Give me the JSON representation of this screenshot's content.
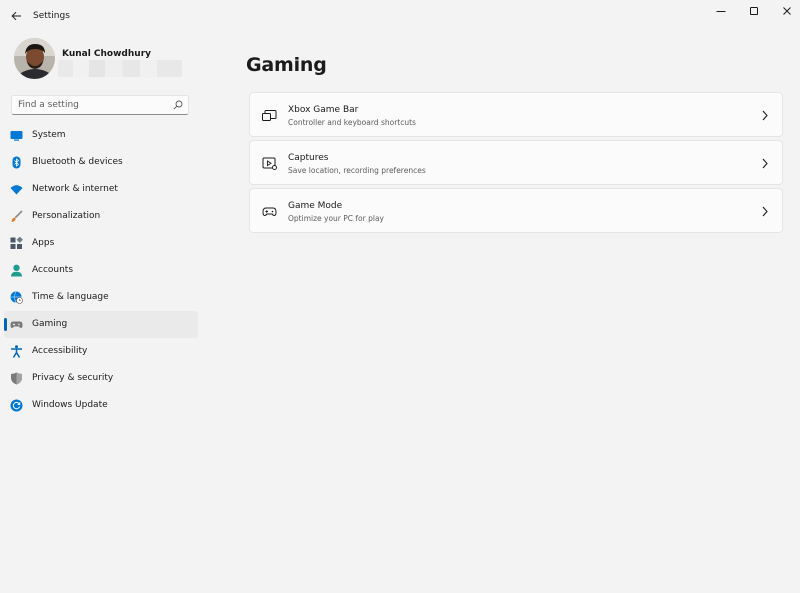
{
  "window": {
    "title": "Settings"
  },
  "profile": {
    "name": "Kunal Chowdhury"
  },
  "search": {
    "placeholder": "Find a setting"
  },
  "sidebar": {
    "items": [
      {
        "label": "System",
        "icon": "system-icon",
        "color": "#0078d4"
      },
      {
        "label": "Bluetooth & devices",
        "icon": "bluetooth-icon",
        "color": "#0078d4"
      },
      {
        "label": "Network & internet",
        "icon": "wifi-icon",
        "color": "#0078d4"
      },
      {
        "label": "Personalization",
        "icon": "paintbrush-icon",
        "color": "#e2731f"
      },
      {
        "label": "Apps",
        "icon": "apps-icon",
        "color": "#4a5867"
      },
      {
        "label": "Accounts",
        "icon": "person-icon",
        "color": "#1f9e8d"
      },
      {
        "label": "Time & language",
        "icon": "globe-clock-icon",
        "color": "#0078d4"
      },
      {
        "label": "Gaming",
        "icon": "gamepad-icon",
        "color": "#7a7a7a",
        "selected": true
      },
      {
        "label": "Accessibility",
        "icon": "accessibility-icon",
        "color": "#0067c0"
      },
      {
        "label": "Privacy & security",
        "icon": "shield-icon",
        "color": "#6b6b6b"
      },
      {
        "label": "Windows Update",
        "icon": "update-icon",
        "color": "#0078d4"
      }
    ]
  },
  "main": {
    "title": "Gaming",
    "cards": [
      {
        "title": "Xbox Game Bar",
        "subtitle": "Controller and keyboard shortcuts",
        "icon": "game-bar-icon"
      },
      {
        "title": "Captures",
        "subtitle": "Save location, recording preferences",
        "icon": "captures-icon"
      },
      {
        "title": "Game Mode",
        "subtitle": "Optimize your PC for play",
        "icon": "game-mode-icon"
      }
    ]
  },
  "colors": {
    "accent": "#0067c0",
    "background": "#f3f3f3",
    "card": "#fbfbfb"
  }
}
